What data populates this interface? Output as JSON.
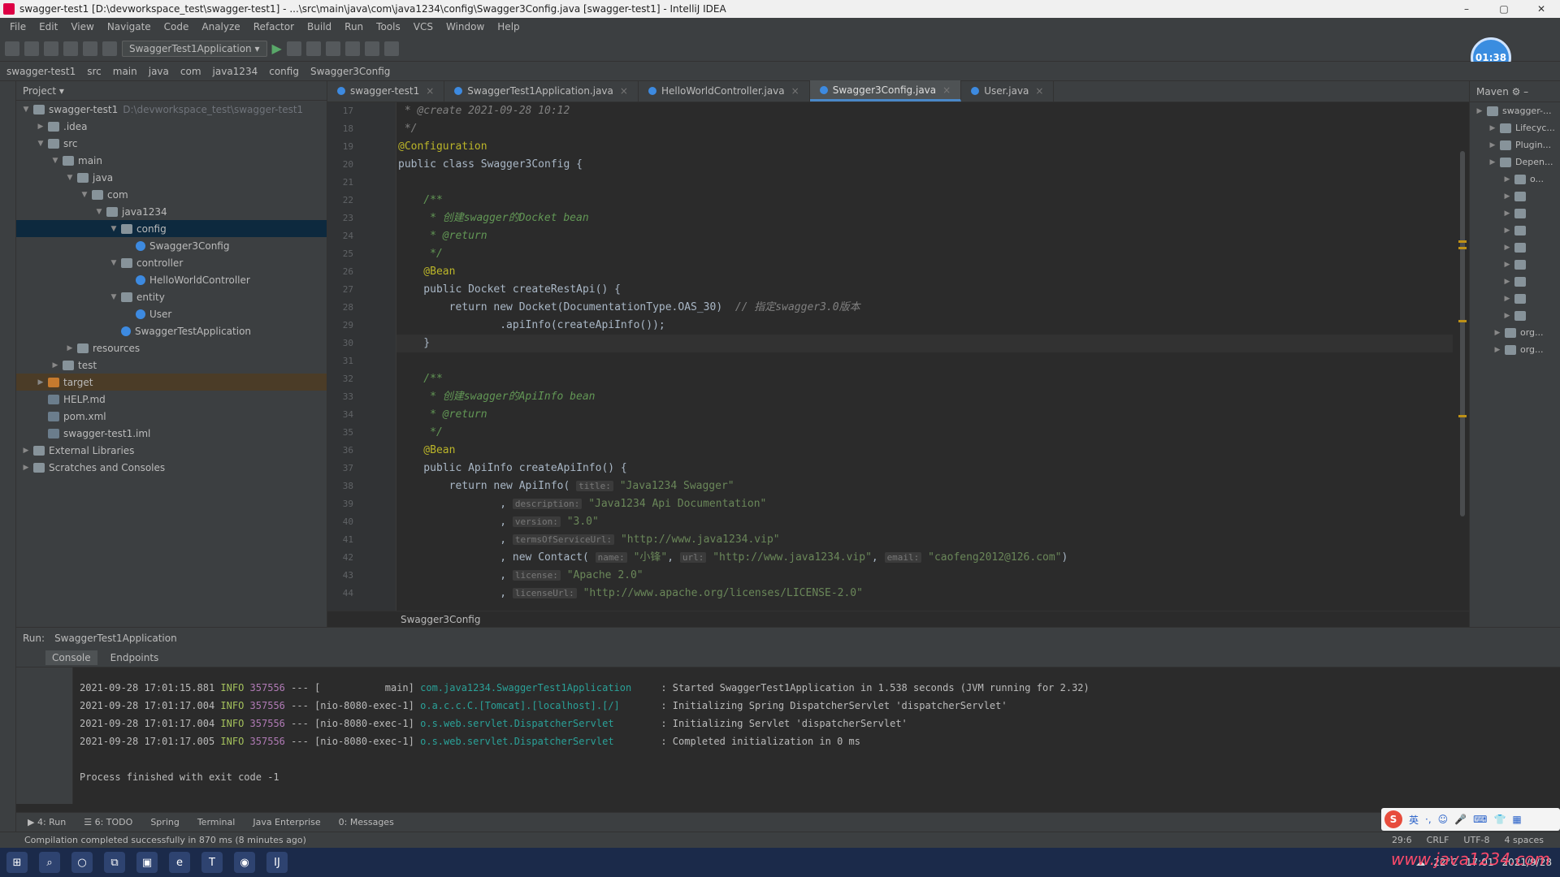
{
  "window": {
    "title": "swagger-test1 [D:\\devworkspace_test\\swagger-test1] - ...\\src\\main\\java\\com\\java1234\\config\\Swagger3Config.java [swagger-test1] - IntelliJ IDEA",
    "minimize": "–",
    "maximize": "▢",
    "close": "✕"
  },
  "menu": [
    "File",
    "Edit",
    "View",
    "Navigate",
    "Code",
    "Analyze",
    "Refactor",
    "Build",
    "Run",
    "Tools",
    "VCS",
    "Window",
    "Help"
  ],
  "toolbar": {
    "run_config": "SwaggerTest1Application ▾",
    "clock": "01:38"
  },
  "breadcrumbs": [
    "swagger-test1",
    "src",
    "main",
    "java",
    "com",
    "java1234",
    "config",
    "Swagger3Config"
  ],
  "project_panel": {
    "title": "Project ▾",
    "tree": [
      {
        "label": "swagger-test1",
        "extra": "D:\\devworkspace_test\\swagger-test1",
        "depth": 0,
        "icon": "folder",
        "open": true
      },
      {
        "label": ".idea",
        "depth": 1,
        "icon": "folder",
        "open": false
      },
      {
        "label": "src",
        "depth": 1,
        "icon": "folder",
        "open": true
      },
      {
        "label": "main",
        "depth": 2,
        "icon": "folder",
        "open": true
      },
      {
        "label": "java",
        "depth": 3,
        "icon": "folder",
        "open": true
      },
      {
        "label": "com",
        "depth": 4,
        "icon": "folder",
        "open": true
      },
      {
        "label": "java1234",
        "depth": 5,
        "icon": "folder",
        "open": true
      },
      {
        "label": "config",
        "depth": 6,
        "icon": "folder",
        "open": true,
        "selected": true
      },
      {
        "label": "Swagger3Config",
        "depth": 7,
        "icon": "class"
      },
      {
        "label": "controller",
        "depth": 6,
        "icon": "folder",
        "open": true
      },
      {
        "label": "HelloWorldController",
        "depth": 7,
        "icon": "class"
      },
      {
        "label": "entity",
        "depth": 6,
        "icon": "folder",
        "open": true
      },
      {
        "label": "User",
        "depth": 7,
        "icon": "class"
      },
      {
        "label": "SwaggerTestApplication",
        "depth": 6,
        "icon": "class"
      },
      {
        "label": "resources",
        "depth": 3,
        "icon": "folder",
        "open": false
      },
      {
        "label": "test",
        "depth": 2,
        "icon": "folder",
        "open": false
      },
      {
        "label": "target",
        "depth": 1,
        "icon": "orange",
        "open": false,
        "highlight": true
      },
      {
        "label": "HELP.md",
        "depth": 1,
        "icon": "file"
      },
      {
        "label": "pom.xml",
        "depth": 1,
        "icon": "file"
      },
      {
        "label": "swagger-test1.iml",
        "depth": 1,
        "icon": "file"
      },
      {
        "label": "External Libraries",
        "depth": 0,
        "icon": "folder",
        "open": false
      },
      {
        "label": "Scratches and Consoles",
        "depth": 0,
        "icon": "folder",
        "open": false
      }
    ]
  },
  "editor_tabs": [
    {
      "label": "swagger-test1",
      "active": false
    },
    {
      "label": "SwaggerTest1Application.java",
      "active": false
    },
    {
      "label": "HelloWorldController.java",
      "active": false
    },
    {
      "label": "Swagger3Config.java",
      "active": true
    },
    {
      "label": "User.java",
      "active": false
    }
  ],
  "gutter_lines": [
    "17",
    "18",
    "19",
    "20",
    "21",
    "22",
    "23",
    "24",
    "25",
    "26",
    "27",
    "28",
    "29",
    "30",
    "31",
    "32",
    "33",
    "34",
    "35",
    "36",
    "37",
    "38",
    "39",
    "40",
    "41",
    "42",
    "43",
    "44"
  ],
  "code": {
    "l17": " * @create 2021-09-28 10:12",
    "l18": " */",
    "l19": "@Configuration",
    "l20": "public class Swagger3Config {",
    "l21": "",
    "l22": "    /**",
    "l23": "     * 创建swagger的Docket bean",
    "l24": "     * @return",
    "l25": "     */",
    "l26": "    @Bean",
    "l27": "    public Docket createRestApi() {",
    "l28a": "        return new Docket(DocumentationType.OAS_30)",
    "l28b": "  // 指定swagger3.0版本",
    "l29": "                .apiInfo(createApiInfo());",
    "l30": "    }",
    "l31": "",
    "l32": "    /**",
    "l33": "     * 创建swagger的ApiInfo bean",
    "l34": "     * @return",
    "l35": "     */",
    "l36": "    @Bean",
    "l37": "    public ApiInfo createApiInfo() {",
    "l38a": "        return new ApiInfo(",
    "l38h": "title:",
    "l38s": "\"Java1234 Swagger\"",
    "l39h": "description:",
    "l39s": "\"Java1234 Api Documentation\"",
    "l40h": "version:",
    "l40s": "\"3.0\"",
    "l41h": "termsOfServiceUrl:",
    "l41s": "\"http://www.java1234.vip\"",
    "l42a": "new Contact(",
    "l42h1": "name:",
    "l42s1": "\"小锋\"",
    "l42h2": "url:",
    "l42s2": "\"http://www.java1234.vip\"",
    "l42h3": "email:",
    "l42s3": "\"caofeng2012@126.com\"",
    "l43h": "license:",
    "l43s": "\"Apache 2.0\"",
    "l44h": "licenseUrl:",
    "l44s": "\"http://www.apache.org/licenses/LICENSE-2.0\""
  },
  "editor_breadcrumb": "Swagger3Config",
  "maven": {
    "title": "Maven ⚙ –",
    "rows": [
      "swagger-...",
      "Lifecyc...",
      "Plugin...",
      "Depen...",
      "o...",
      "",
      "",
      "",
      "",
      "",
      "",
      "",
      "",
      "org...",
      "org..."
    ]
  },
  "run": {
    "label": "Run:",
    "config": "SwaggerTest1Application",
    "tabs": [
      "Console",
      "Endpoints"
    ],
    "logs": [
      {
        "ts": "2021-09-28 17:01:15.881",
        "level": "INFO",
        "pid": "357556",
        "sep": "---",
        "thread": "[           main]",
        "logger": "com.java1234.SwaggerTest1Application    ",
        "msg": ": Started SwaggerTest1Application in 1.538 seconds (JVM running for 2.32)"
      },
      {
        "ts": "2021-09-28 17:01:17.004",
        "level": "INFO",
        "pid": "357556",
        "sep": "---",
        "thread": "[nio-8080-exec-1]",
        "logger": "o.a.c.c.C.[Tomcat].[localhost].[/]      ",
        "msg": ": Initializing Spring DispatcherServlet 'dispatcherServlet'"
      },
      {
        "ts": "2021-09-28 17:01:17.004",
        "level": "INFO",
        "pid": "357556",
        "sep": "---",
        "thread": "[nio-8080-exec-1]",
        "logger": "o.s.web.servlet.DispatcherServlet       ",
        "msg": ": Initializing Servlet 'dispatcherServlet'"
      },
      {
        "ts": "2021-09-28 17:01:17.005",
        "level": "INFO",
        "pid": "357556",
        "sep": "---",
        "thread": "[nio-8080-exec-1]",
        "logger": "o.s.web.servlet.DispatcherServlet       ",
        "msg": ": Completed initialization in 0 ms"
      }
    ],
    "exit": "Process finished with exit code -1"
  },
  "bottom_tools": [
    "▶ 4: Run",
    "☰ 6: TODO",
    "Spring",
    "Terminal",
    "Java Enterprise",
    "0: Messages"
  ],
  "status": {
    "message": "Compilation completed successfully in 870 ms (8 minutes ago)",
    "position": "29:6",
    "lf": "CRLF",
    "encoding": "UTF-8",
    "indent": "4 spaces"
  },
  "ime": {
    "logo": "S",
    "lang": "英"
  },
  "taskbar": {
    "weather": "22°C",
    "time": "17:01",
    "date": "2021/9/28"
  },
  "watermark": "www.java1234.com"
}
